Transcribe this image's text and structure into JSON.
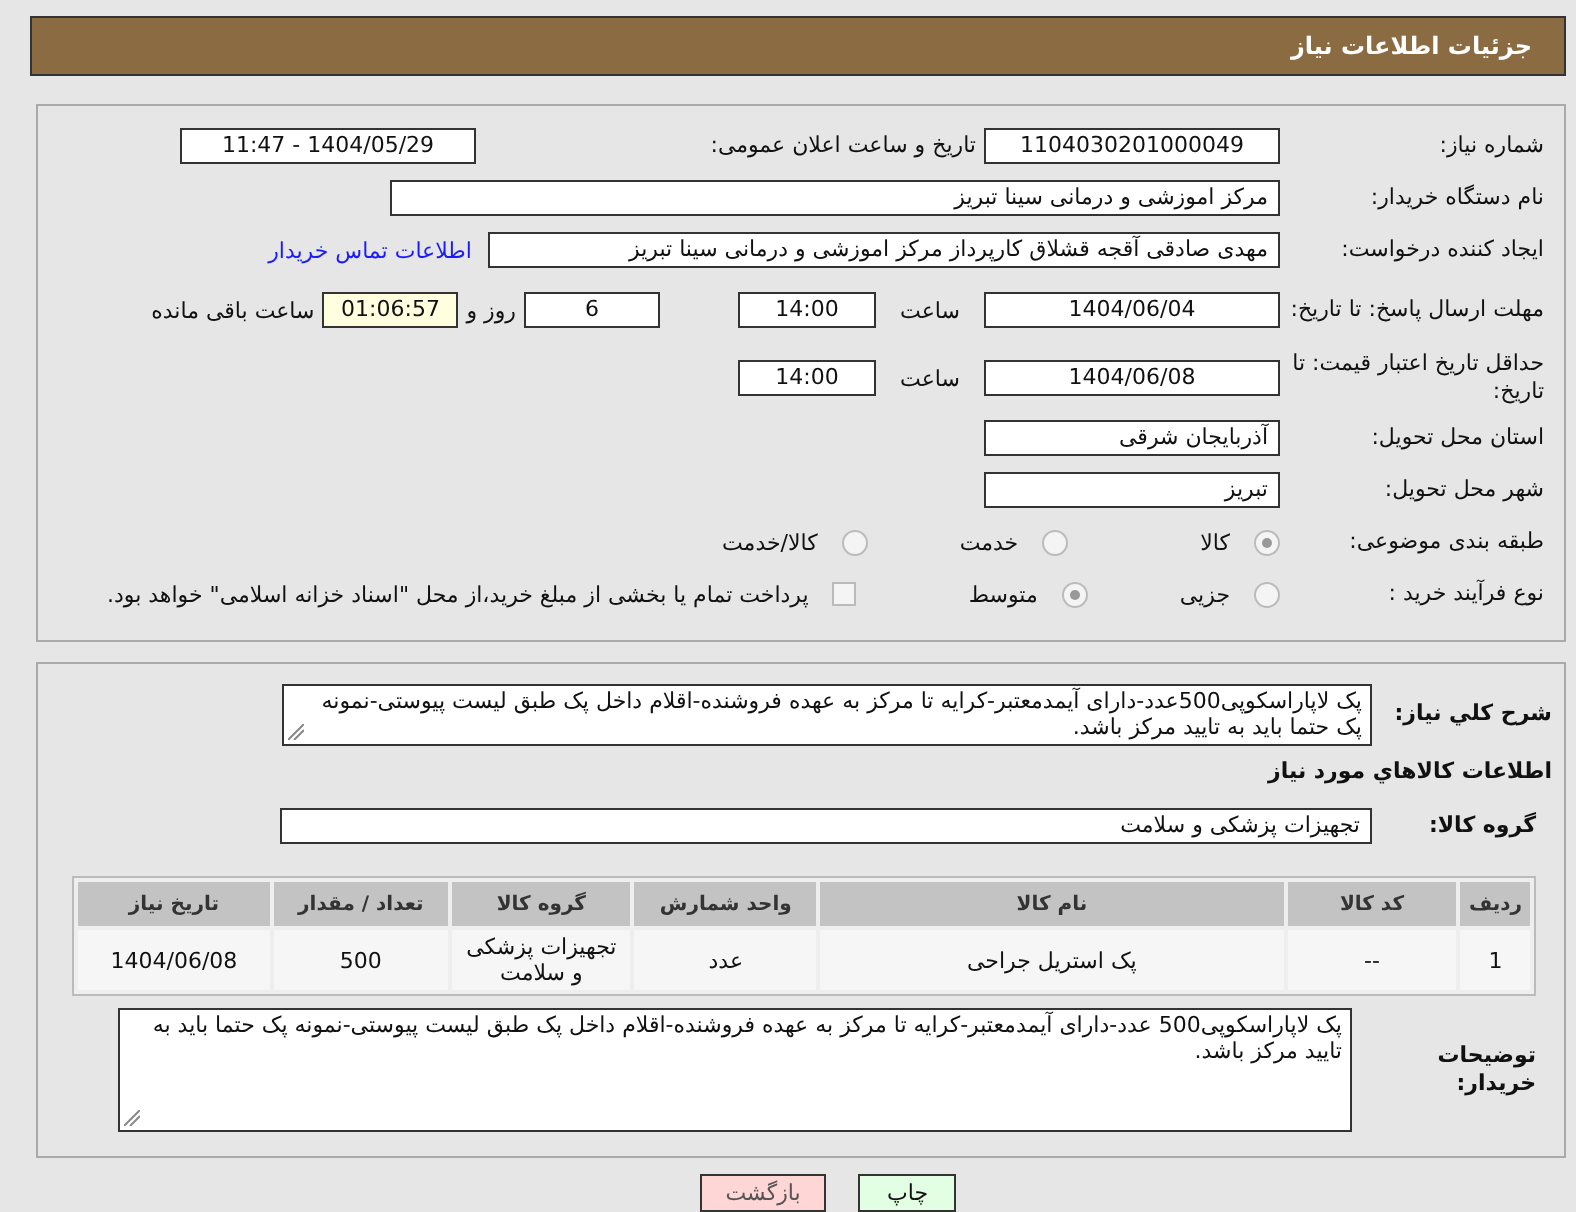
{
  "header": {
    "title": "جزئیات اطلاعات نیاز"
  },
  "need_info": {
    "need_number": {
      "label": "شماره نیاز:",
      "value": "1104030201000049"
    },
    "announce_datetime": {
      "label": "تاریخ و ساعت اعلان عمومی:",
      "value": "1404/05/29 - 11:47"
    },
    "buyer_org": {
      "label": "نام دستگاه خریدار:",
      "value": "مرکز اموزشی و درمانی سینا تبریز"
    },
    "requester": {
      "label": "ایجاد کننده درخواست:",
      "value": "مهدی صادقی آقجه قشلاق کارپرداز مرکز اموزشی و درمانی سینا تبریز",
      "link": "اطلاعات تماس خریدار"
    },
    "response_deadline": {
      "label": "مهلت ارسال پاسخ: تا تاریخ:",
      "date": "1404/06/04",
      "time_label": "ساعت",
      "time": "14:00",
      "days": "6",
      "days_label": "روز و",
      "remaining": "01:06:57",
      "remaining_label": "ساعت باقی مانده"
    },
    "price_validity": {
      "label": "حداقل تاریخ اعتبار قیمت: تا تاریخ:",
      "date": "1404/06/08",
      "time_label": "ساعت",
      "time": "14:00"
    },
    "province": {
      "label": "استان محل تحویل:",
      "value": "آذربایجان شرقی"
    },
    "city": {
      "label": "شهر محل تحویل:",
      "value": "تبریز"
    },
    "category": {
      "label": "طبقه بندی موضوعی:",
      "options": [
        {
          "label": "کالا",
          "selected": true
        },
        {
          "label": "خدمت",
          "selected": false
        },
        {
          "label": "کالا/خدمت",
          "selected": false
        }
      ]
    },
    "purchase_process": {
      "label": "نوع فرآیند خرید :",
      "options": [
        {
          "label": "جزیی",
          "selected": false
        },
        {
          "label": "متوسط",
          "selected": true
        }
      ],
      "payment_note": {
        "checked": false,
        "text": "پرداخت تمام یا بخشی از مبلغ خرید،از محل \"اسناد خزانه اسلامی\" خواهد بود."
      }
    }
  },
  "need_description": {
    "label": "شرح کلي نياز:",
    "value": "پک لاپاراسکوپی500عدد-دارای آیمدمعتبر-کرایه تا مرکز به عهده فروشنده-اقلام  داخل پک طبق لیست پیوستی-نمونه پک حتما باید به تایید مرکز باشد."
  },
  "goods_section": {
    "title": "اطلاعات كالاهاي مورد نياز",
    "group": {
      "label": "گروه کالا:",
      "value": "تجهیزات پزشکی و سلامت"
    },
    "table": {
      "columns": [
        "ردیف",
        "کد کالا",
        "نام کالا",
        "واحد شمارش",
        "گروه کالا",
        "تعداد / مقدار",
        "تاریخ نیاز"
      ],
      "rows": [
        [
          "1",
          "--",
          "پک استریل جراحی",
          "عدد",
          "تجهیزات پزشکی و سلامت",
          "500",
          "1404/06/08"
        ]
      ]
    },
    "buyer_notes": {
      "label": "توضیحات خریدار:",
      "value": "پک لاپاراسکوپی500 عدد-دارای آیمدمعتبر-کرایه تا مرکز به عهده فروشنده-اقلام  داخل پک طبق لیست پیوستی-نمونه پک حتما باید به تایید مرکز باشد."
    }
  },
  "buttons": [
    {
      "label": "چاپ",
      "kind": "print"
    },
    {
      "label": "بازگشت",
      "kind": "back"
    }
  ]
}
